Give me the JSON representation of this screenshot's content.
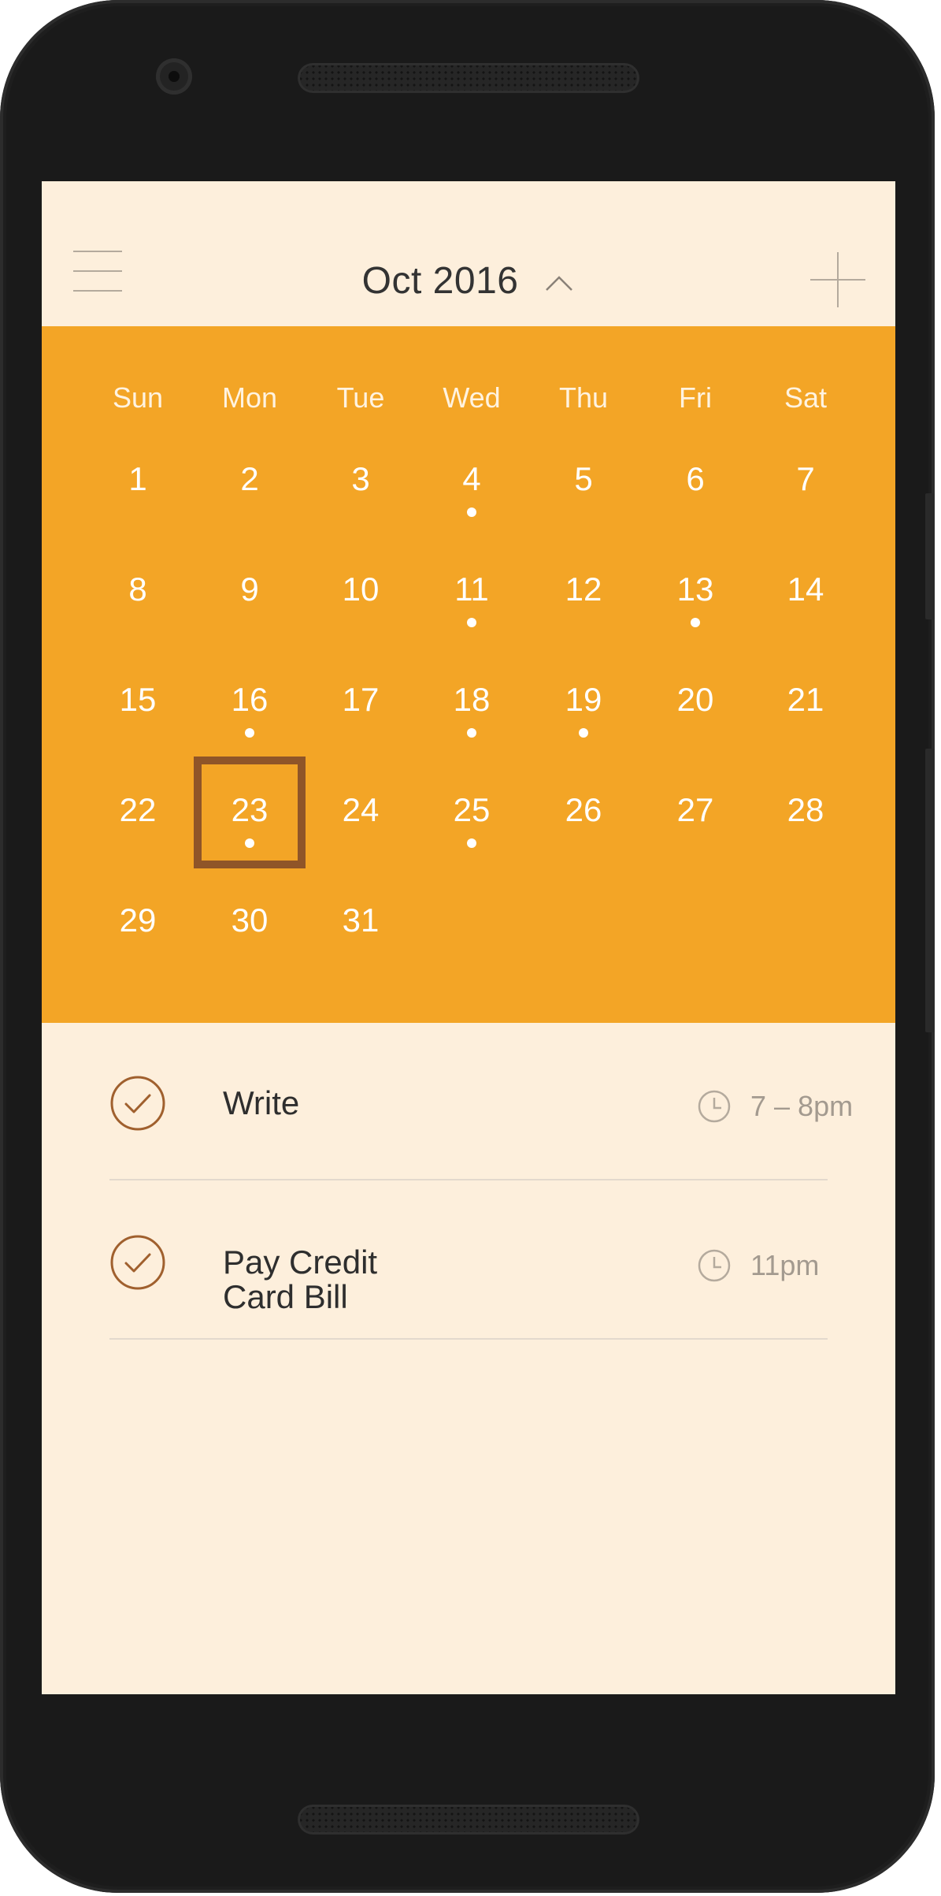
{
  "header": {
    "month_title": "Oct 2016",
    "menu_icon": "hamburger-icon",
    "expand_icon": "chevron-up-icon",
    "add_icon": "plus-icon"
  },
  "calendar": {
    "weekdays": [
      "Sun",
      "Mon",
      "Tue",
      "Wed",
      "Thu",
      "Fri",
      "Sat"
    ],
    "weeks": [
      [
        "1",
        "2",
        "3",
        "4",
        "5",
        "6",
        "7"
      ],
      [
        "8",
        "9",
        "10",
        "11",
        "12",
        "13",
        "14"
      ],
      [
        "15",
        "16",
        "17",
        "18",
        "19",
        "20",
        "21"
      ],
      [
        "22",
        "23",
        "24",
        "25",
        "26",
        "27",
        "28"
      ],
      [
        "29",
        "30",
        "31"
      ]
    ],
    "days_with_events": [
      "4",
      "11",
      "13",
      "16",
      "18",
      "19",
      "23",
      "25"
    ],
    "selected_day": "23"
  },
  "tasks": [
    {
      "title": "Write",
      "time": "7 – 8pm",
      "status_icon": "check-circle-icon",
      "time_icon": "clock-icon"
    },
    {
      "title": "Pay Credit\nCard Bill",
      "time": "11pm",
      "status_icon": "check-circle-icon",
      "time_icon": "clock-icon"
    }
  ],
  "colors": {
    "accent": "#f3a526",
    "background": "#fdefdc",
    "selected_border": "#8f5528",
    "check": "#a0602e",
    "icon_muted": "#b4aa9d",
    "time_text": "#a39a8f",
    "title_text": "#2e2e2e"
  }
}
